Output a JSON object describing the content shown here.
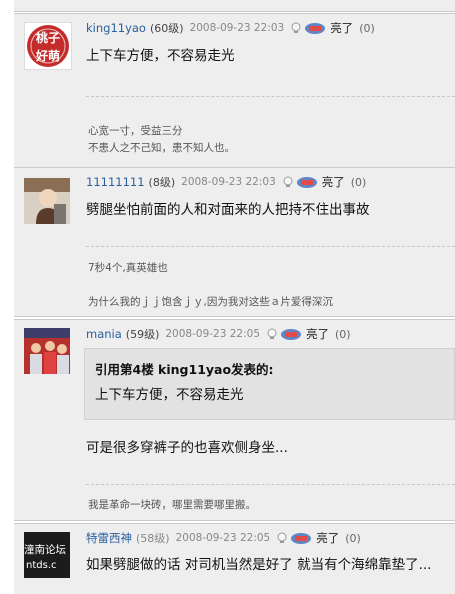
{
  "posts": [
    {
      "user": "king11yao",
      "level": "(60级)",
      "date": "2008-09-23 22:03",
      "liang": "亮了",
      "count": "(0)",
      "avatar_text_1": "桃子",
      "avatar_text_2": "好萌",
      "body": "上下车方便，不容易走光",
      "sig_1": "心宽一寸，受益三分",
      "sig_2": "不患人之不己知，患不知人也。"
    },
    {
      "user": "11111111",
      "level": "(8级)",
      "date": "2008-09-23 22:03",
      "liang": "亮了",
      "count": "(0)",
      "body": "劈腿坐怕前面的人和对面来的人把持不住出事故",
      "sig_1": "7秒4个,真英雄也",
      "sig_2": "为什么我的ｊｊ饱含ｊｙ,因为我对这些ａ片爱得深沉"
    },
    {
      "user": "mania",
      "level": "(59级)",
      "date": "2008-09-23 22:05",
      "liang": "亮了",
      "count": "(0)",
      "quote_title": "引用第4楼  king11yao发表的:",
      "quote_body": "上下车方便，不容易走光",
      "body": "可是很多穿裤子的也喜欢侧身坐...",
      "sig_1": "我是革命一块砖，哪里需要哪里搬。"
    },
    {
      "user": "特雷西神",
      "level": "(58级)",
      "date": "2008-09-23 22:05",
      "liang": "亮了",
      "count": "(0)",
      "avatar_text_1": "潼南论坛",
      "avatar_text_2": "ntds.c",
      "body": "如果劈腿做的话  对司机当然是好了  就当有个海绵靠垫了..."
    }
  ],
  "colors": {
    "username": "#2a5f9e",
    "post_bg": "#eeeeee",
    "quote_bg": "#e2e2e2"
  }
}
